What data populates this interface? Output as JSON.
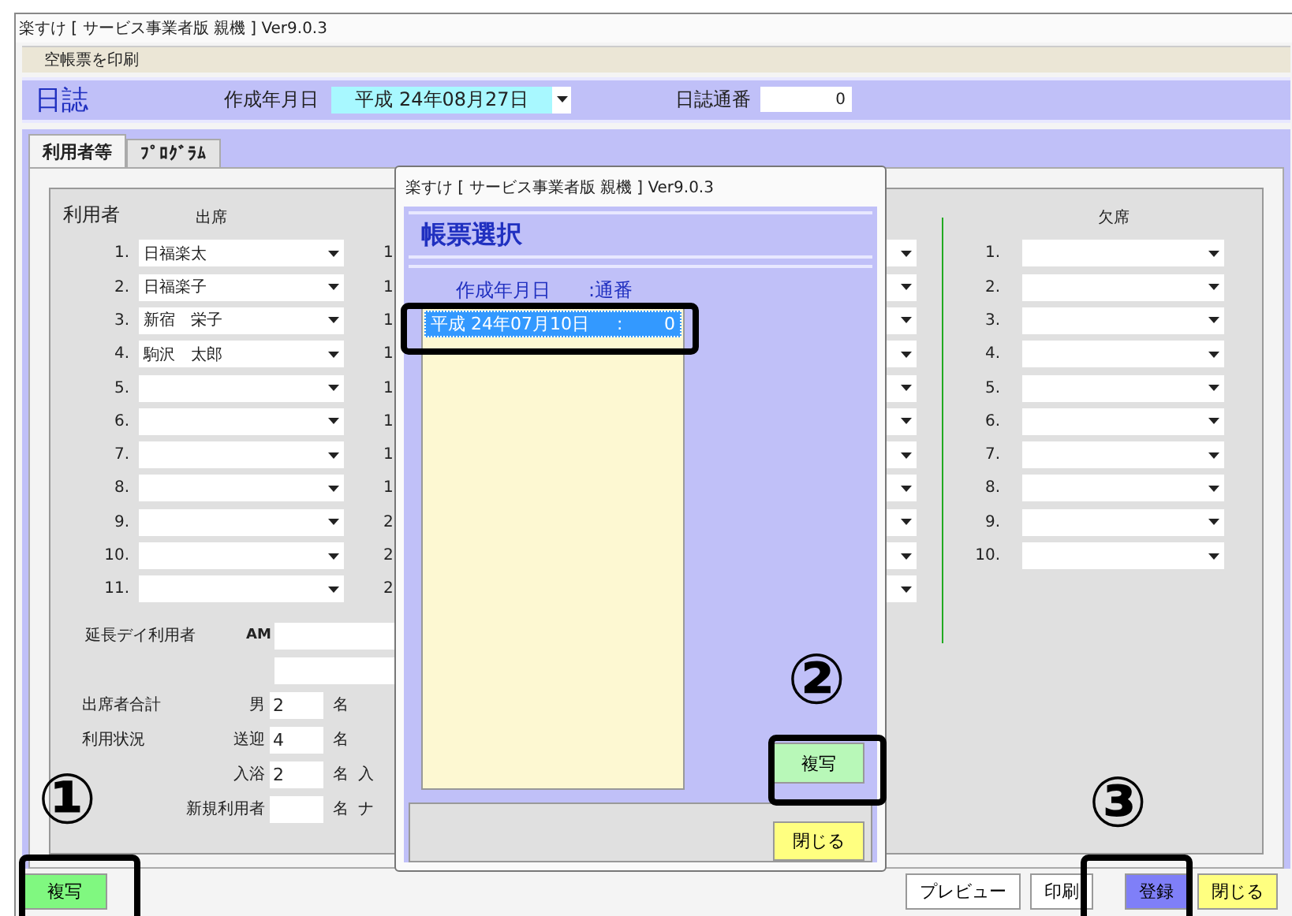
{
  "window": {
    "title": "楽すけ [ サービス事業者版 親機 ] Ver9.0.3"
  },
  "menu": [
    "空帳票を印刷"
  ],
  "header": {
    "title": "日誌",
    "date_label": "作成年月日",
    "date_value": "平成 24年08月27日",
    "serial_label": "日誌通番",
    "serial_value": "0"
  },
  "tabs": [
    {
      "label": "利用者等",
      "selected": true
    },
    {
      "label": "ﾌﾟﾛｸﾞﾗﾑ",
      "selected": false
    }
  ],
  "users": {
    "label": "利用者",
    "attend_heading": "出席",
    "absent_heading": "欠席",
    "attend": [
      {
        "no": "1.",
        "name": "日福楽太",
        "col2": "1"
      },
      {
        "no": "2.",
        "name": "日福楽子",
        "col2": "1"
      },
      {
        "no": "3.",
        "name": "新宿　栄子",
        "col2": "1"
      },
      {
        "no": "4.",
        "name": "駒沢　太郎",
        "col2": "1"
      },
      {
        "no": "5.",
        "col2": "1"
      },
      {
        "no": "6.",
        "col2": "1"
      },
      {
        "no": "7.",
        "col2": "1"
      },
      {
        "no": "8.",
        "col2": "1"
      },
      {
        "no": "9.",
        "col2": "2"
      },
      {
        "no": "10.",
        "col2": "2"
      },
      {
        "no": "11.",
        "col2": "2"
      }
    ],
    "absent": [
      {
        "no": "1."
      },
      {
        "no": "2."
      },
      {
        "no": "3."
      },
      {
        "no": "4."
      },
      {
        "no": "5."
      },
      {
        "no": "6."
      },
      {
        "no": "7."
      },
      {
        "no": "8."
      },
      {
        "no": "9."
      },
      {
        "no": "10."
      }
    ]
  },
  "extended": {
    "label": "延長デイ利用者",
    "am_label": "AM"
  },
  "totals": [
    {
      "label": "出席者合計",
      "sub": "男",
      "value": "2",
      "unit": "名"
    },
    {
      "label": "利用状況",
      "sub": "送迎",
      "value": "4",
      "unit": "名"
    },
    {
      "sub": "入浴",
      "value": "2",
      "unit": "名",
      "next": "入"
    },
    {
      "sub": "新規利用者",
      "unit": "名",
      "next": "ナ"
    }
  ],
  "footer": {
    "left": {
      "label": "複写"
    },
    "right": [
      {
        "label": "プレビュー",
        "kind": "plain"
      },
      {
        "label": "印刷",
        "kind": "plain"
      },
      {
        "label": "登録",
        "kind": "primary"
      },
      {
        "label": "閉じる",
        "kind": "close"
      }
    ]
  },
  "dialog": {
    "title": "楽すけ [ サービス事業者版 親機 ] Ver9.0.3",
    "heading": "帳票選択",
    "col_date": "作成年月日",
    "col_serial": ":通番",
    "rows": [
      {
        "date": "平成 24年07月10日",
        "sep": ":",
        "serial": "0",
        "selected": true
      }
    ],
    "copy": "複写",
    "close": "閉じる"
  },
  "annotations": [
    {
      "mark": "①"
    },
    {
      "mark": "②"
    },
    {
      "mark": "③"
    }
  ]
}
